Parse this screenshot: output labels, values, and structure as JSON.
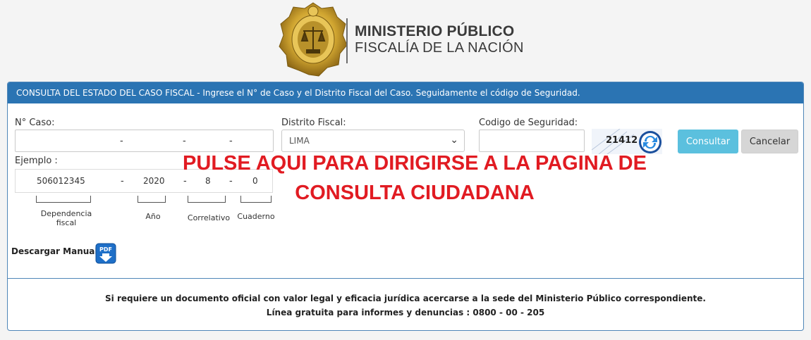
{
  "brand": {
    "line1": "MINISTERIO PÚBLICO",
    "line2": "FISCALÍA DE LA NACIÓN",
    "logo_icon": "ministry-seal-icon"
  },
  "panel": {
    "header": "CONSULTA DEL ESTADO DEL CASO FISCAL - Ingrese el N° de Caso y el Distrito Fiscal del Caso. Seguidamente el código de Seguridad."
  },
  "form": {
    "caso_label": "N° Caso:",
    "distrito_label": "Distrito Fiscal:",
    "distrito_value": "LIMA",
    "codigo_label": "Codigo de Seguridad:",
    "captcha_value": "21412",
    "consultar_label": "Consultar",
    "cancelar_label": "Cancelar"
  },
  "example": {
    "label": "Ejemplo :",
    "dependencia": "506012345",
    "anio": "2020",
    "correlativo": "8",
    "cuaderno": "0",
    "dependencia_label_1": "Dependencia",
    "dependencia_label_2": "fiscal",
    "anio_label": "Año",
    "correlativo_label": "Correlativo",
    "cuaderno_label": "Cuaderno"
  },
  "overlay": {
    "line1": "PULSE AQUI PARA DIRIGIRSE A LA PAGINA DE",
    "line2": "CONSULTA CIUDADANA"
  },
  "manual": {
    "label": "Descargar Manual",
    "icon": "pdf-download-icon"
  },
  "footer": {
    "line1": "Si requiere un documento oficial con valor legal y eficacia jurídica acercarse a la sede del Ministerio Público correspondiente.",
    "line2": "Línea gratuita para informes y denuncias : 0800 - 00 - 205"
  },
  "colors": {
    "header_blue": "#2b74b3",
    "overlay_red": "#e11b22",
    "primary_button": "#5bc0de",
    "gold": "#c9a227"
  }
}
